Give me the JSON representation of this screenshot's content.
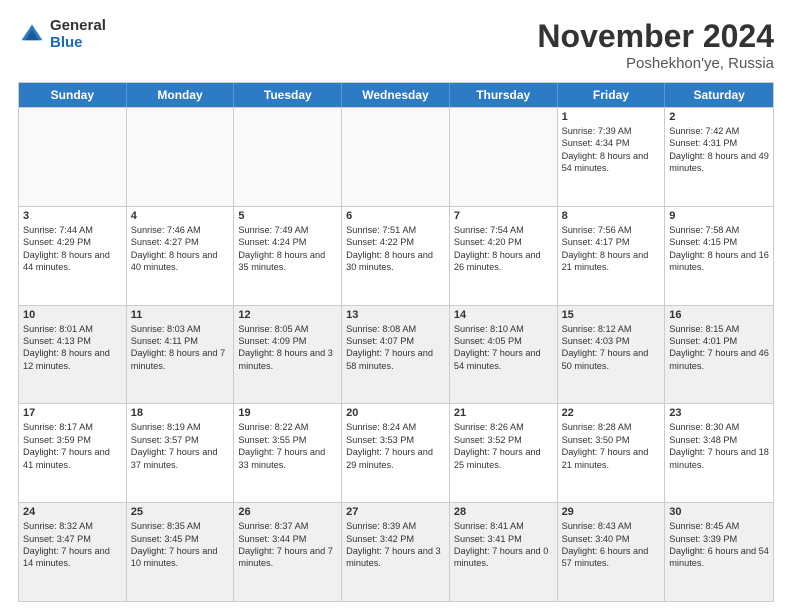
{
  "header": {
    "logo": {
      "general": "General",
      "blue": "Blue"
    },
    "title": "November 2024",
    "location": "Poshekhon'ye, Russia"
  },
  "days_of_week": [
    "Sunday",
    "Monday",
    "Tuesday",
    "Wednesday",
    "Thursday",
    "Friday",
    "Saturday"
  ],
  "weeks": [
    [
      {
        "day": "",
        "empty": true
      },
      {
        "day": "",
        "empty": true
      },
      {
        "day": "",
        "empty": true
      },
      {
        "day": "",
        "empty": true
      },
      {
        "day": "",
        "empty": true
      },
      {
        "day": "1",
        "sunrise": "Sunrise: 7:39 AM",
        "sunset": "Sunset: 4:34 PM",
        "daylight": "Daylight: 8 hours and 54 minutes."
      },
      {
        "day": "2",
        "sunrise": "Sunrise: 7:42 AM",
        "sunset": "Sunset: 4:31 PM",
        "daylight": "Daylight: 8 hours and 49 minutes."
      }
    ],
    [
      {
        "day": "3",
        "sunrise": "Sunrise: 7:44 AM",
        "sunset": "Sunset: 4:29 PM",
        "daylight": "Daylight: 8 hours and 44 minutes."
      },
      {
        "day": "4",
        "sunrise": "Sunrise: 7:46 AM",
        "sunset": "Sunset: 4:27 PM",
        "daylight": "Daylight: 8 hours and 40 minutes."
      },
      {
        "day": "5",
        "sunrise": "Sunrise: 7:49 AM",
        "sunset": "Sunset: 4:24 PM",
        "daylight": "Daylight: 8 hours and 35 minutes."
      },
      {
        "day": "6",
        "sunrise": "Sunrise: 7:51 AM",
        "sunset": "Sunset: 4:22 PM",
        "daylight": "Daylight: 8 hours and 30 minutes."
      },
      {
        "day": "7",
        "sunrise": "Sunrise: 7:54 AM",
        "sunset": "Sunset: 4:20 PM",
        "daylight": "Daylight: 8 hours and 26 minutes."
      },
      {
        "day": "8",
        "sunrise": "Sunrise: 7:56 AM",
        "sunset": "Sunset: 4:17 PM",
        "daylight": "Daylight: 8 hours and 21 minutes."
      },
      {
        "day": "9",
        "sunrise": "Sunrise: 7:58 AM",
        "sunset": "Sunset: 4:15 PM",
        "daylight": "Daylight: 8 hours and 16 minutes."
      }
    ],
    [
      {
        "day": "10",
        "sunrise": "Sunrise: 8:01 AM",
        "sunset": "Sunset: 4:13 PM",
        "daylight": "Daylight: 8 hours and 12 minutes."
      },
      {
        "day": "11",
        "sunrise": "Sunrise: 8:03 AM",
        "sunset": "Sunset: 4:11 PM",
        "daylight": "Daylight: 8 hours and 7 minutes."
      },
      {
        "day": "12",
        "sunrise": "Sunrise: 8:05 AM",
        "sunset": "Sunset: 4:09 PM",
        "daylight": "Daylight: 8 hours and 3 minutes."
      },
      {
        "day": "13",
        "sunrise": "Sunrise: 8:08 AM",
        "sunset": "Sunset: 4:07 PM",
        "daylight": "Daylight: 7 hours and 58 minutes."
      },
      {
        "day": "14",
        "sunrise": "Sunrise: 8:10 AM",
        "sunset": "Sunset: 4:05 PM",
        "daylight": "Daylight: 7 hours and 54 minutes."
      },
      {
        "day": "15",
        "sunrise": "Sunrise: 8:12 AM",
        "sunset": "Sunset: 4:03 PM",
        "daylight": "Daylight: 7 hours and 50 minutes."
      },
      {
        "day": "16",
        "sunrise": "Sunrise: 8:15 AM",
        "sunset": "Sunset: 4:01 PM",
        "daylight": "Daylight: 7 hours and 46 minutes."
      }
    ],
    [
      {
        "day": "17",
        "sunrise": "Sunrise: 8:17 AM",
        "sunset": "Sunset: 3:59 PM",
        "daylight": "Daylight: 7 hours and 41 minutes."
      },
      {
        "day": "18",
        "sunrise": "Sunrise: 8:19 AM",
        "sunset": "Sunset: 3:57 PM",
        "daylight": "Daylight: 7 hours and 37 minutes."
      },
      {
        "day": "19",
        "sunrise": "Sunrise: 8:22 AM",
        "sunset": "Sunset: 3:55 PM",
        "daylight": "Daylight: 7 hours and 33 minutes."
      },
      {
        "day": "20",
        "sunrise": "Sunrise: 8:24 AM",
        "sunset": "Sunset: 3:53 PM",
        "daylight": "Daylight: 7 hours and 29 minutes."
      },
      {
        "day": "21",
        "sunrise": "Sunrise: 8:26 AM",
        "sunset": "Sunset: 3:52 PM",
        "daylight": "Daylight: 7 hours and 25 minutes."
      },
      {
        "day": "22",
        "sunrise": "Sunrise: 8:28 AM",
        "sunset": "Sunset: 3:50 PM",
        "daylight": "Daylight: 7 hours and 21 minutes."
      },
      {
        "day": "23",
        "sunrise": "Sunrise: 8:30 AM",
        "sunset": "Sunset: 3:48 PM",
        "daylight": "Daylight: 7 hours and 18 minutes."
      }
    ],
    [
      {
        "day": "24",
        "sunrise": "Sunrise: 8:32 AM",
        "sunset": "Sunset: 3:47 PM",
        "daylight": "Daylight: 7 hours and 14 minutes."
      },
      {
        "day": "25",
        "sunrise": "Sunrise: 8:35 AM",
        "sunset": "Sunset: 3:45 PM",
        "daylight": "Daylight: 7 hours and 10 minutes."
      },
      {
        "day": "26",
        "sunrise": "Sunrise: 8:37 AM",
        "sunset": "Sunset: 3:44 PM",
        "daylight": "Daylight: 7 hours and 7 minutes."
      },
      {
        "day": "27",
        "sunrise": "Sunrise: 8:39 AM",
        "sunset": "Sunset: 3:42 PM",
        "daylight": "Daylight: 7 hours and 3 minutes."
      },
      {
        "day": "28",
        "sunrise": "Sunrise: 8:41 AM",
        "sunset": "Sunset: 3:41 PM",
        "daylight": "Daylight: 7 hours and 0 minutes."
      },
      {
        "day": "29",
        "sunrise": "Sunrise: 8:43 AM",
        "sunset": "Sunset: 3:40 PM",
        "daylight": "Daylight: 6 hours and 57 minutes."
      },
      {
        "day": "30",
        "sunrise": "Sunrise: 8:45 AM",
        "sunset": "Sunset: 3:39 PM",
        "daylight": "Daylight: 6 hours and 54 minutes."
      }
    ]
  ]
}
